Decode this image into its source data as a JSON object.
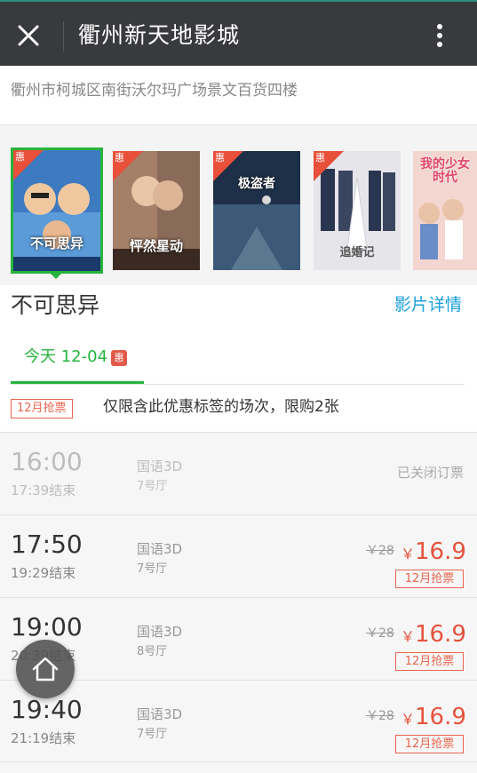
{
  "titlebar": {
    "title": "衢州新天地影城",
    "close_icon": "close-icon",
    "more_icon": "more-vertical-icon"
  },
  "cinema": {
    "address": "衢州市柯城区南街沃尔玛广场景文百货四楼"
  },
  "posters": [
    {
      "ribbon": "惠",
      "title": "不可思异",
      "selected": true,
      "bg": "#3a6fb0"
    },
    {
      "ribbon": "惠",
      "title": "怦然星动",
      "selected": false,
      "bg": "#7a5a4a"
    },
    {
      "ribbon": "惠",
      "title": "极盗者",
      "selected": false,
      "bg": "#2c3f5a"
    },
    {
      "ribbon": "惠",
      "title": "追婚记",
      "selected": false,
      "bg": "#c9c9cf"
    },
    {
      "ribbon": "",
      "title": "我的少女时代",
      "selected": false,
      "bg": "#e8b8b4"
    }
  ],
  "movie": {
    "title": "不可思异",
    "detail_link": "影片详情"
  },
  "date_tab": {
    "label": "今天 12-04",
    "badge": "惠"
  },
  "promo": {
    "tag": "12月抢票",
    "text": "仅限含此优惠标签的场次，限购2张"
  },
  "showtimes": [
    {
      "start": "16:00",
      "end": "17:39结束",
      "lang": "国语3D",
      "hall": "7号厅",
      "status": "已关闭订票",
      "disabled": true
    },
    {
      "start": "17:50",
      "end": "19:29结束",
      "lang": "国语3D",
      "hall": "7号厅",
      "orig_price": "￥28",
      "currency": "￥",
      "price": "16.9",
      "tag": "12月抢票"
    },
    {
      "start": "19:00",
      "end": "20:39结束",
      "lang": "国语3D",
      "hall": "8号厅",
      "orig_price": "￥28",
      "currency": "￥",
      "price": "16.9",
      "tag": "12月抢票"
    },
    {
      "start": "19:40",
      "end": "21:19结束",
      "lang": "国语3D",
      "hall": "7号厅",
      "orig_price": "￥28",
      "currency": "￥",
      "price": "16.9",
      "tag": "12月抢票"
    }
  ],
  "fab": {
    "icon": "home-icon"
  },
  "colors": {
    "accent_green": "#27b43c",
    "price_red": "#e5533d",
    "link_blue": "#1ca0dc",
    "titlebar": "#393a3e"
  }
}
